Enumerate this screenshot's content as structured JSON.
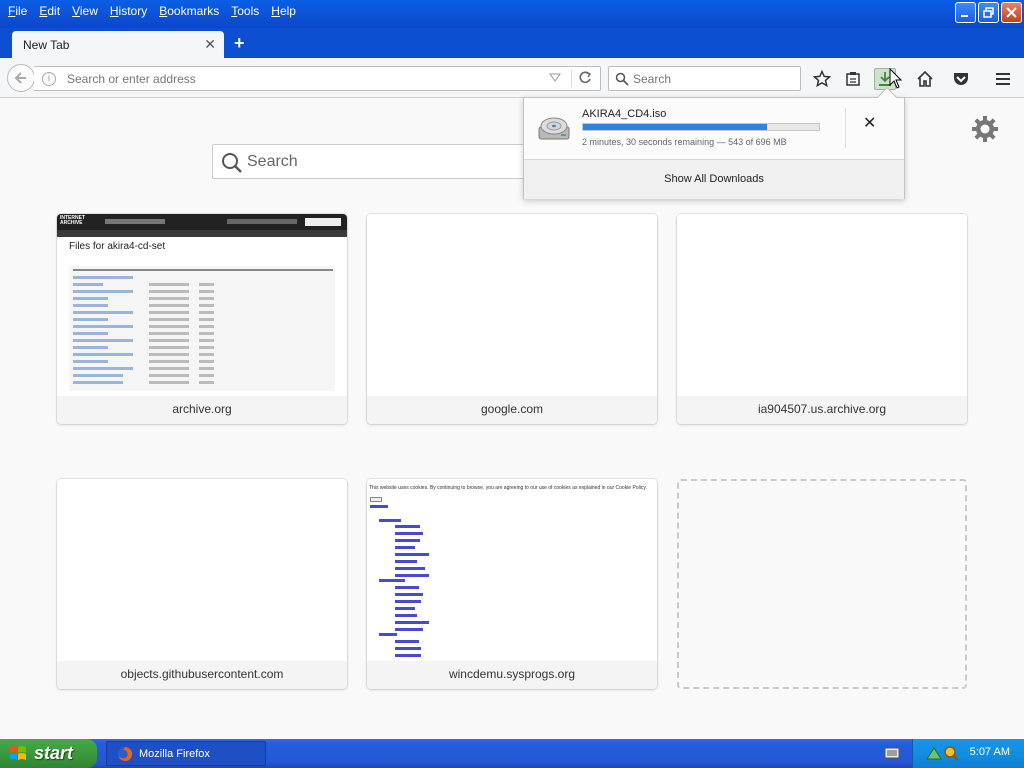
{
  "window": {
    "menu": [
      {
        "label": "File",
        "key": "F",
        "rest": "ile"
      },
      {
        "label": "Edit",
        "key": "E",
        "rest": "dit"
      },
      {
        "label": "View",
        "key": "V",
        "rest": "iew"
      },
      {
        "label": "History",
        "key": "H",
        "rest": "istory"
      },
      {
        "label": "Bookmarks",
        "key": "B",
        "rest": "ookmarks"
      },
      {
        "label": "Tools",
        "key": "T",
        "rest": "ools"
      },
      {
        "label": "Help",
        "key": "H",
        "rest": "elp"
      }
    ]
  },
  "tabs": [
    {
      "title": "New Tab",
      "active": true
    }
  ],
  "navbar": {
    "url_placeholder": "Search or enter address",
    "search_placeholder": "Search"
  },
  "newtab": {
    "search_placeholder": "Search",
    "tiles": [
      {
        "caption": "archive.org",
        "thumb_heading": "Files for akira4-cd-set"
      },
      {
        "caption": "google.com"
      },
      {
        "caption": "ia904507.us.archive.org"
      },
      {
        "caption": "objects.githubusercontent.com"
      },
      {
        "caption": "wincdemu.sysprogs.org",
        "thumb_text": "This website uses cookies. By continuing to browse, you are agreeing to our use of cookies as explained in our Cookie Policy."
      }
    ]
  },
  "downloads": {
    "item": {
      "filename": "AKIRA4_CD4.iso",
      "status": "2 minutes, 30 seconds remaining — 543 of 696 MB",
      "progress_fraction": 0.78
    },
    "footer": "Show All Downloads"
  },
  "taskbar": {
    "start_label": "start",
    "tasks": [
      {
        "label": "Mozilla Firefox"
      }
    ],
    "clock": "5:07 AM"
  },
  "colors": {
    "progress": "#2d83e0",
    "titlebar": "#0c54d8",
    "start": "#3c9a3e"
  }
}
